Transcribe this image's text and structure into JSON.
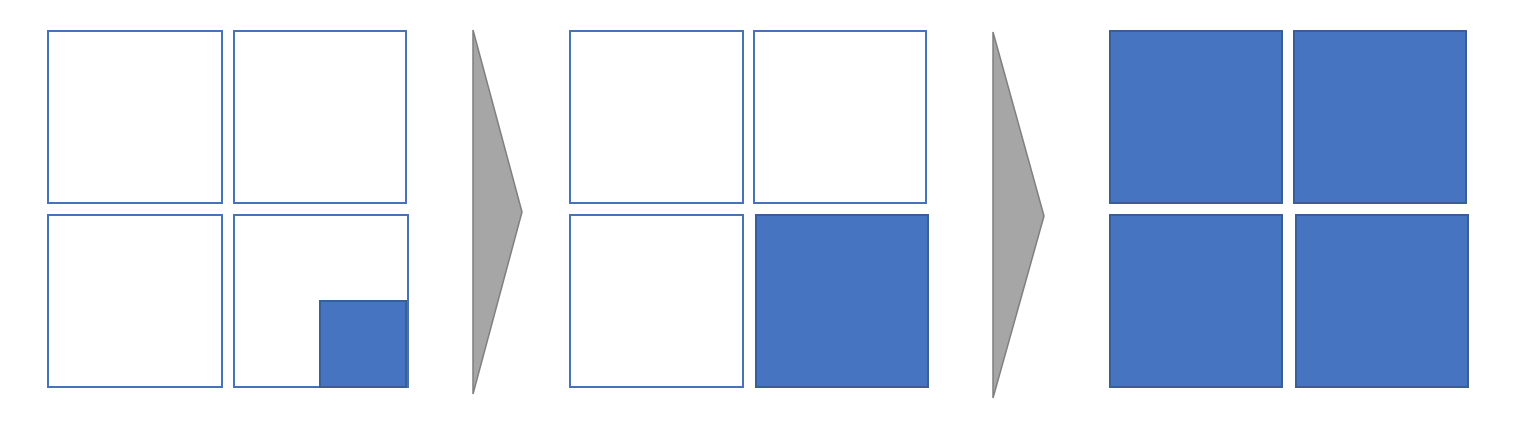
{
  "colors": {
    "cell_border": "#4672B6",
    "cell_fill": "#4674C1",
    "filled_border": "#3A5F97",
    "arrow_fill": "#A6A6A6",
    "arrow_stroke": "#7F7F7F"
  },
  "stages": [
    {
      "cells": [
        {
          "fill": "empty"
        },
        {
          "fill": "empty"
        },
        {
          "fill": "empty"
        },
        {
          "fill": "partial",
          "fraction": 0.25
        }
      ]
    },
    {
      "cells": [
        {
          "fill": "empty"
        },
        {
          "fill": "empty"
        },
        {
          "fill": "empty"
        },
        {
          "fill": "full"
        }
      ]
    },
    {
      "cells": [
        {
          "fill": "full"
        },
        {
          "fill": "full"
        },
        {
          "fill": "full"
        },
        {
          "fill": "full"
        }
      ]
    }
  ],
  "arrows": [
    {
      "icon": "chevron-right-icon"
    },
    {
      "icon": "chevron-right-icon"
    }
  ]
}
